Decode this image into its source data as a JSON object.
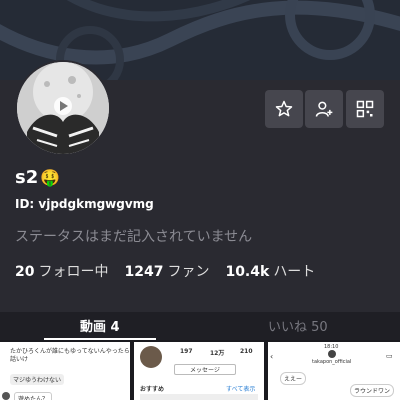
{
  "profile": {
    "username": "s2",
    "emoji": "🤑",
    "id_label": "ID: vjpdgkmgwgvmg",
    "status": "ステータスはまだ記入されていません"
  },
  "stats": [
    {
      "value": "20",
      "label": "フォロー中"
    },
    {
      "value": "1247",
      "label": "ファン"
    },
    {
      "value": "10.4k",
      "label": "ハート"
    }
  ],
  "actions": [
    "star-icon",
    "add-user-icon",
    "qr-code-icon"
  ],
  "tabs": {
    "videos": "動画 4",
    "likes": "いいね 50"
  },
  "thumbnails": {
    "t1": {
      "line1": "たかひろくんが誰にもゆってないんやったら",
      "line2": "話いけ",
      "line3": "マジゆうわけない",
      "line4": "遊めたん？"
    },
    "t2": {
      "n1": "197",
      "n2": "12万",
      "n3": "210",
      "button": "メッセージ",
      "label": "おすすめ",
      "link": "すべて表示"
    },
    "t3": {
      "time": "18:10",
      "name": "takapon_official",
      "msg1": "ええー",
      "msg2": "ラウンドワン"
    }
  }
}
